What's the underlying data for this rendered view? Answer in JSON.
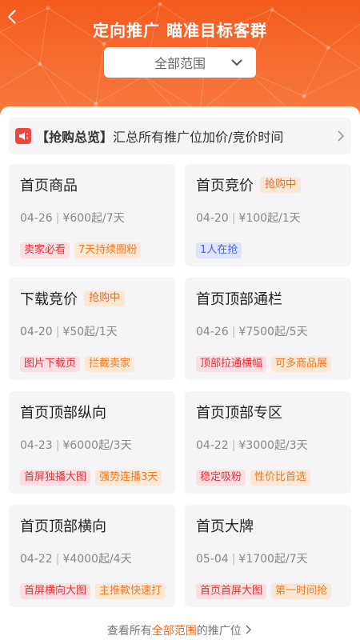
{
  "header": {
    "title": "定向推广 瞄准目标客群",
    "scope_value": "全部范围",
    "accent_color": "#f45a1e"
  },
  "notice": {
    "bold_label": "【抢购总览】",
    "text": "汇总所有推广位加价/竞价时间"
  },
  "cards": [
    {
      "title": "首页商品",
      "badge": "",
      "date": "04-26",
      "price": "¥600起/7天",
      "tags": [
        {
          "text": "卖家必看",
          "style": "pink"
        },
        {
          "text": "7天持续圈粉",
          "style": "orange"
        }
      ]
    },
    {
      "title": "首页竞价",
      "badge": "抢购中",
      "date": "04-20",
      "price": "¥100起/1天",
      "tags": [
        {
          "text": "1人在抢",
          "style": "blue"
        }
      ]
    },
    {
      "title": "下载竞价",
      "badge": "抢购中",
      "date": "04-20",
      "price": "¥50起/1天",
      "tags": [
        {
          "text": "图片下载页",
          "style": "pink"
        },
        {
          "text": "拦截卖家",
          "style": "orange"
        }
      ]
    },
    {
      "title": "首页顶部通栏",
      "badge": "",
      "date": "04-26",
      "price": "¥7500起/5天",
      "tags": [
        {
          "text": "顶部拉通横幅",
          "style": "pink"
        },
        {
          "text": "可多商品展",
          "style": "orange"
        }
      ]
    },
    {
      "title": "首页顶部纵向",
      "badge": "",
      "date": "04-23",
      "price": "¥6000起/3天",
      "tags": [
        {
          "text": "首屏独播大图",
          "style": "pink"
        },
        {
          "text": "强势连播3天",
          "style": "orange"
        }
      ]
    },
    {
      "title": "首页顶部专区",
      "badge": "",
      "date": "04-22",
      "price": "¥3000起/3天",
      "tags": [
        {
          "text": "稳定吸粉",
          "style": "pink"
        },
        {
          "text": "性价比首选",
          "style": "orange"
        }
      ]
    },
    {
      "title": "首页顶部横向",
      "badge": "",
      "date": "04-22",
      "price": "¥4000起/4天",
      "tags": [
        {
          "text": "首屏横向大图",
          "style": "pink"
        },
        {
          "text": "主推款快速打",
          "style": "orange"
        }
      ]
    },
    {
      "title": "首页大牌",
      "badge": "",
      "date": "05-04",
      "price": "¥1700起/7天",
      "tags": [
        {
          "text": "首页首屏大图",
          "style": "pink"
        },
        {
          "text": "第一时间抢",
          "style": "orange"
        }
      ]
    }
  ],
  "footer": {
    "prefix": "查看所有",
    "accent": "全部范围",
    "suffix": "的推广位"
  }
}
